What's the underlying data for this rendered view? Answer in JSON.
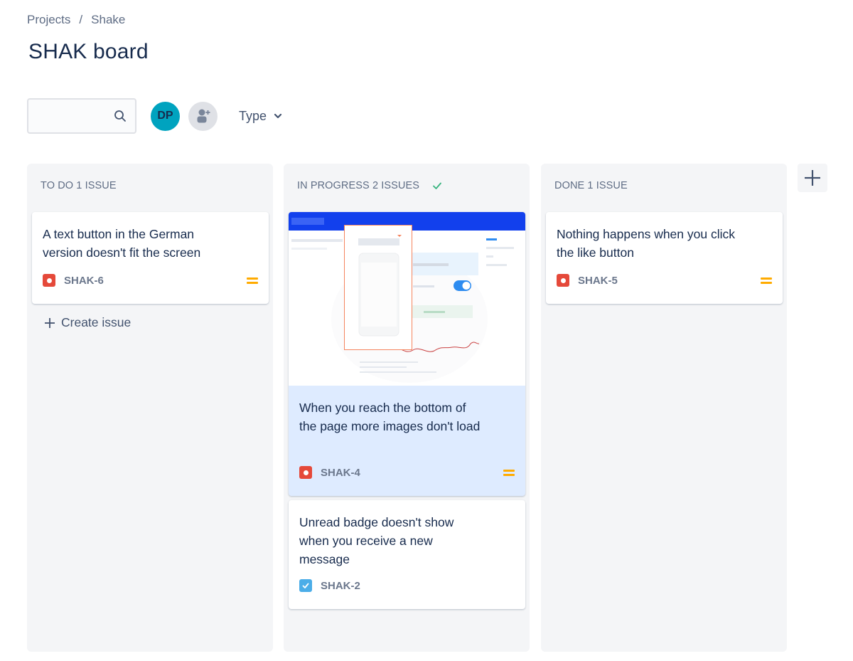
{
  "breadcrumb": {
    "items": [
      "Projects",
      "Shake"
    ],
    "separator": "/"
  },
  "page": {
    "title": "SHAK board"
  },
  "toolbar": {
    "search": {
      "value": "",
      "placeholder": ""
    },
    "avatars": [
      {
        "initials": "DP",
        "color": "#00a3bf"
      }
    ],
    "add_people_icon": "add-person-icon",
    "type_filter_label": "Type"
  },
  "columns": [
    {
      "id": "todo",
      "header": "TO DO 1 ISSUE",
      "cards": [
        {
          "title": "A text button in the German version doesn't fit the screen",
          "key": "SHAK-6",
          "type": "bug",
          "priority": "medium"
        }
      ],
      "create_label": "Create issue"
    },
    {
      "id": "in-progress",
      "header": "IN PROGRESS 2 ISSUES",
      "header_icon": "check-icon",
      "cards": [
        {
          "title": "When you reach the bottom of the page more images don't load",
          "key": "SHAK-4",
          "type": "bug",
          "priority": "medium",
          "has_attachment": true,
          "selected": true
        },
        {
          "title": "Unread badge doesn't show when you receive a new message",
          "key": "SHAK-2",
          "type": "task"
        }
      ]
    },
    {
      "id": "done",
      "header": "DONE 1 ISSUE",
      "cards": [
        {
          "title": "Nothing happens when you click the like button",
          "key": "SHAK-5",
          "type": "bug",
          "priority": "medium"
        }
      ]
    }
  ],
  "colors": {
    "bug": "#e5493a",
    "task": "#4bade8",
    "priority_medium": "#ffab00",
    "selected_card": "#deebff",
    "column_bg": "#f4f5f7"
  }
}
